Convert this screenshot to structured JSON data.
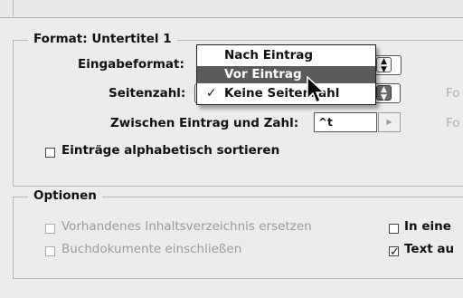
{
  "format": {
    "group_title": "Format: Untertitel 1",
    "eingabeformat_label": "Eingabeformat:",
    "seitenzahl_label": "Seitenzahl:",
    "seitenzahl_partial": "Keine Seite",
    "seitenzahl_tail": "ahl",
    "zwischen_label": "Zwischen Eintrag und Zahl:",
    "zwischen_value": "^t",
    "sort_label": "Einträge alphabetisch sortieren",
    "cut_right_labels": [
      "Fo",
      "Fo"
    ]
  },
  "dropdown_menu": {
    "items": [
      {
        "label": "Nach Eintrag",
        "highlighted": false,
        "checked": false
      },
      {
        "label": "Vor Eintrag",
        "highlighted": true,
        "checked": false
      },
      {
        "label": "Keine Seitenzahl",
        "highlighted": false,
        "checked": true
      }
    ],
    "check_glyph": "✓"
  },
  "optionen": {
    "group_title": "Optionen",
    "replace_toc_label": "Vorhandenes Inhaltsverzeichnis ersetzen",
    "include_book_label": "Buchdokumente einschließen",
    "right_option_1": "In eine",
    "right_option_2": "Text au",
    "right_option_2_checked": true
  },
  "colors": {
    "background": "#ececec",
    "highlight": "#5b5b5b",
    "disabled_text": "#9a9a9a"
  }
}
